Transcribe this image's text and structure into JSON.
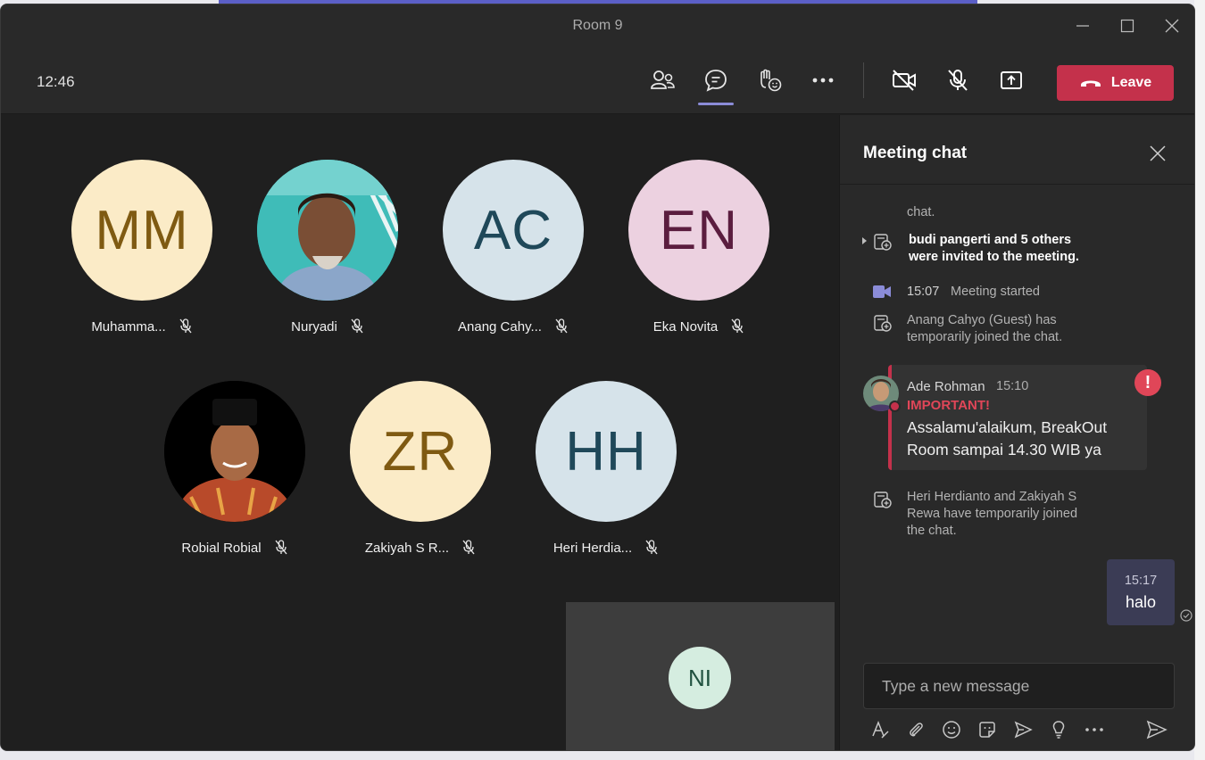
{
  "window": {
    "title": "Room 9"
  },
  "toolbar": {
    "clock": "12:46",
    "leave_label": "Leave",
    "icons": [
      "people-icon",
      "chat-icon",
      "raise-hand-icon",
      "more-icon",
      "camera-off-icon",
      "mic-off-icon",
      "share-tray-icon"
    ]
  },
  "participants": [
    {
      "initials": "MM",
      "name": "Muhamma...",
      "bg": "#fbebc7",
      "fg": "#7f5a12"
    },
    {
      "initials": "",
      "name": "Nuryadi",
      "photo": true
    },
    {
      "initials": "AC",
      "name": "Anang Cahy...",
      "bg": "#d6e3ea",
      "fg": "#1f4859"
    },
    {
      "initials": "EN",
      "name": "Eka Novita",
      "bg": "#ecd1e0",
      "fg": "#5b1d3f"
    },
    {
      "initials": "",
      "name": "Robial Robial",
      "photo": true
    },
    {
      "initials": "ZR",
      "name": "Zakiyah S R...",
      "bg": "#fbebc7",
      "fg": "#7f5a12"
    },
    {
      "initials": "HH",
      "name": "Heri Herdia...",
      "bg": "#d6e3ea",
      "fg": "#1f4859"
    }
  ],
  "self": {
    "initials": "NI"
  },
  "chat": {
    "title": "Meeting chat",
    "sys1_tail": "chat.",
    "sys2_line1": "budi pangerti and 5 others",
    "sys2_line2": "were invited to the meeting.",
    "sys3_time": "15:07",
    "sys3_text": "Meeting started",
    "sys4_line1": "Anang Cahyo (Guest) has",
    "sys4_line2": "temporarily joined the chat.",
    "message": {
      "author": "Ade Rohman",
      "time": "15:10",
      "importance": "IMPORTANT!",
      "badge": "!",
      "body": "Assalamu'alaikum, BreakOut Room sampai 14.30 WIB ya"
    },
    "sys5_line1": "Heri Herdianto and Zakiyah S",
    "sys5_line2": "Rewa have temporarily joined",
    "sys5_line3": "the chat.",
    "own": {
      "time": "15:17",
      "text": "halo"
    },
    "compose_placeholder": "Type a new message"
  },
  "colors": {
    "leave": "#c4314b",
    "accent": "#8b8cd8",
    "important": "#e04658"
  }
}
